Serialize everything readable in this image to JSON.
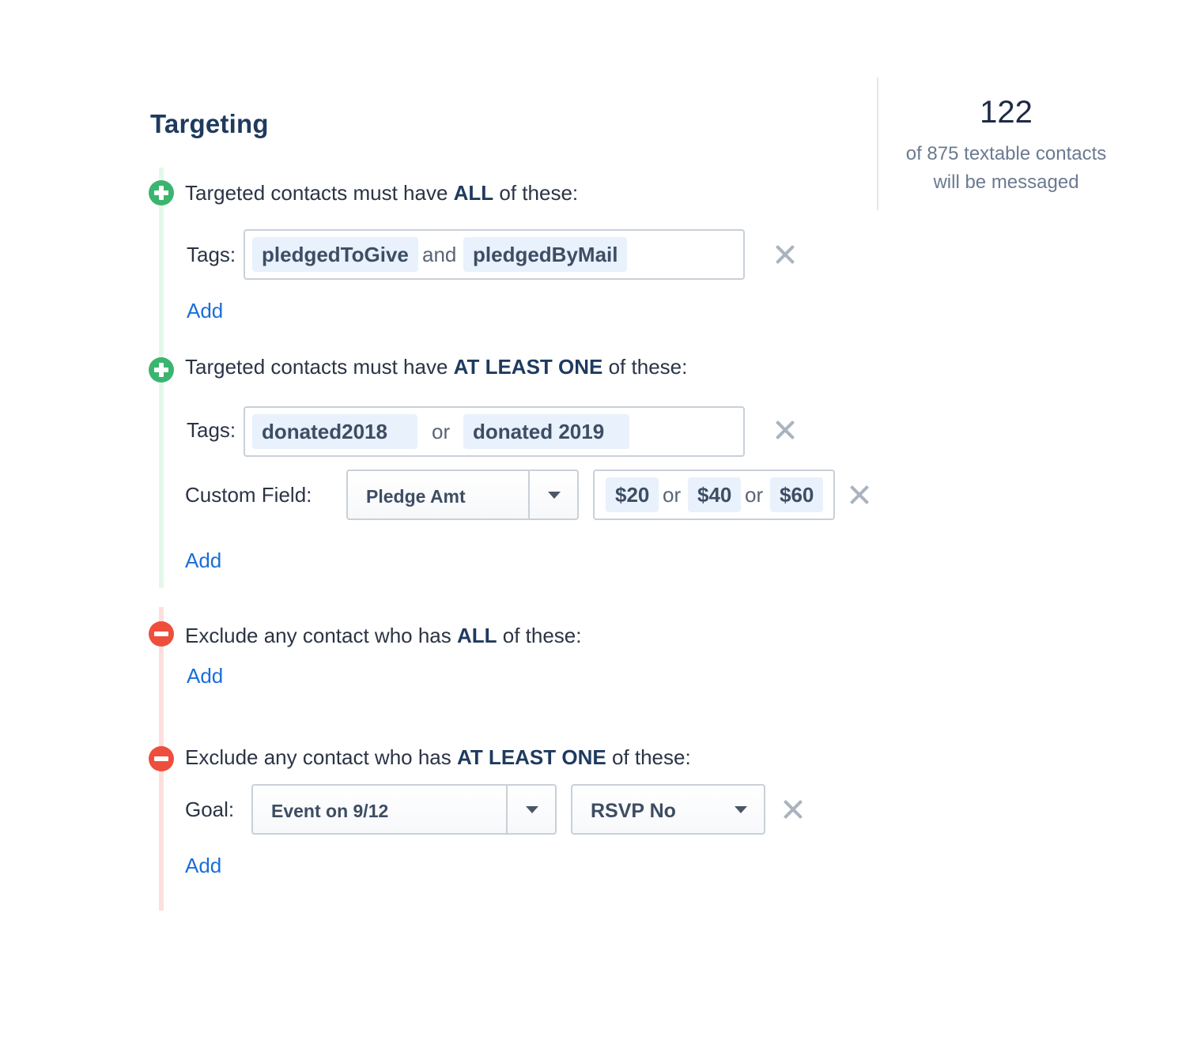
{
  "title": "Targeting",
  "summary": {
    "count": "122",
    "line1": "of 875 textable contacts",
    "line2": "will be messaged"
  },
  "groups": [
    {
      "type": "include",
      "heading_pre": "Targeted contacts must have ",
      "heading_bold": "ALL",
      "heading_post": " of these:",
      "tags_label": "Tags:",
      "tags": [
        "pledgedToGive",
        "pledgedByMail"
      ],
      "conjunction": "and",
      "add_label": "Add"
    },
    {
      "type": "include",
      "heading_pre": "Targeted contacts must have ",
      "heading_bold": "AT LEAST ONE",
      "heading_post": " of these:",
      "tags_label": "Tags:",
      "tags": [
        "donated2018",
        "donated 2019"
      ],
      "conjunction": "or",
      "custom_field_label": "Custom Field:",
      "custom_field_select": "Pledge Amt",
      "custom_values": [
        "$20",
        "$40",
        "$60"
      ],
      "add_label": "Add"
    },
    {
      "type": "exclude",
      "heading_pre": "Exclude any contact who has ",
      "heading_bold": "ALL",
      "heading_post": " of these:",
      "add_label": "Add"
    },
    {
      "type": "exclude",
      "heading_pre": "Exclude any contact who has ",
      "heading_bold": "AT LEAST ONE",
      "heading_post": " of these:",
      "goal_label": "Goal:",
      "goal_select": "Event on 9/12",
      "goal_status": "RSVP No",
      "add_label": "Add"
    }
  ],
  "colors": {
    "include": "#3ab56f",
    "exclude": "#ee4e3c",
    "link": "#1a6ed8",
    "chip": "#e8f1fc"
  },
  "icons": {
    "include": "plus-circle-icon",
    "exclude": "minus-circle-icon",
    "remove": "close-icon",
    "dropdown": "caret-down-icon"
  }
}
